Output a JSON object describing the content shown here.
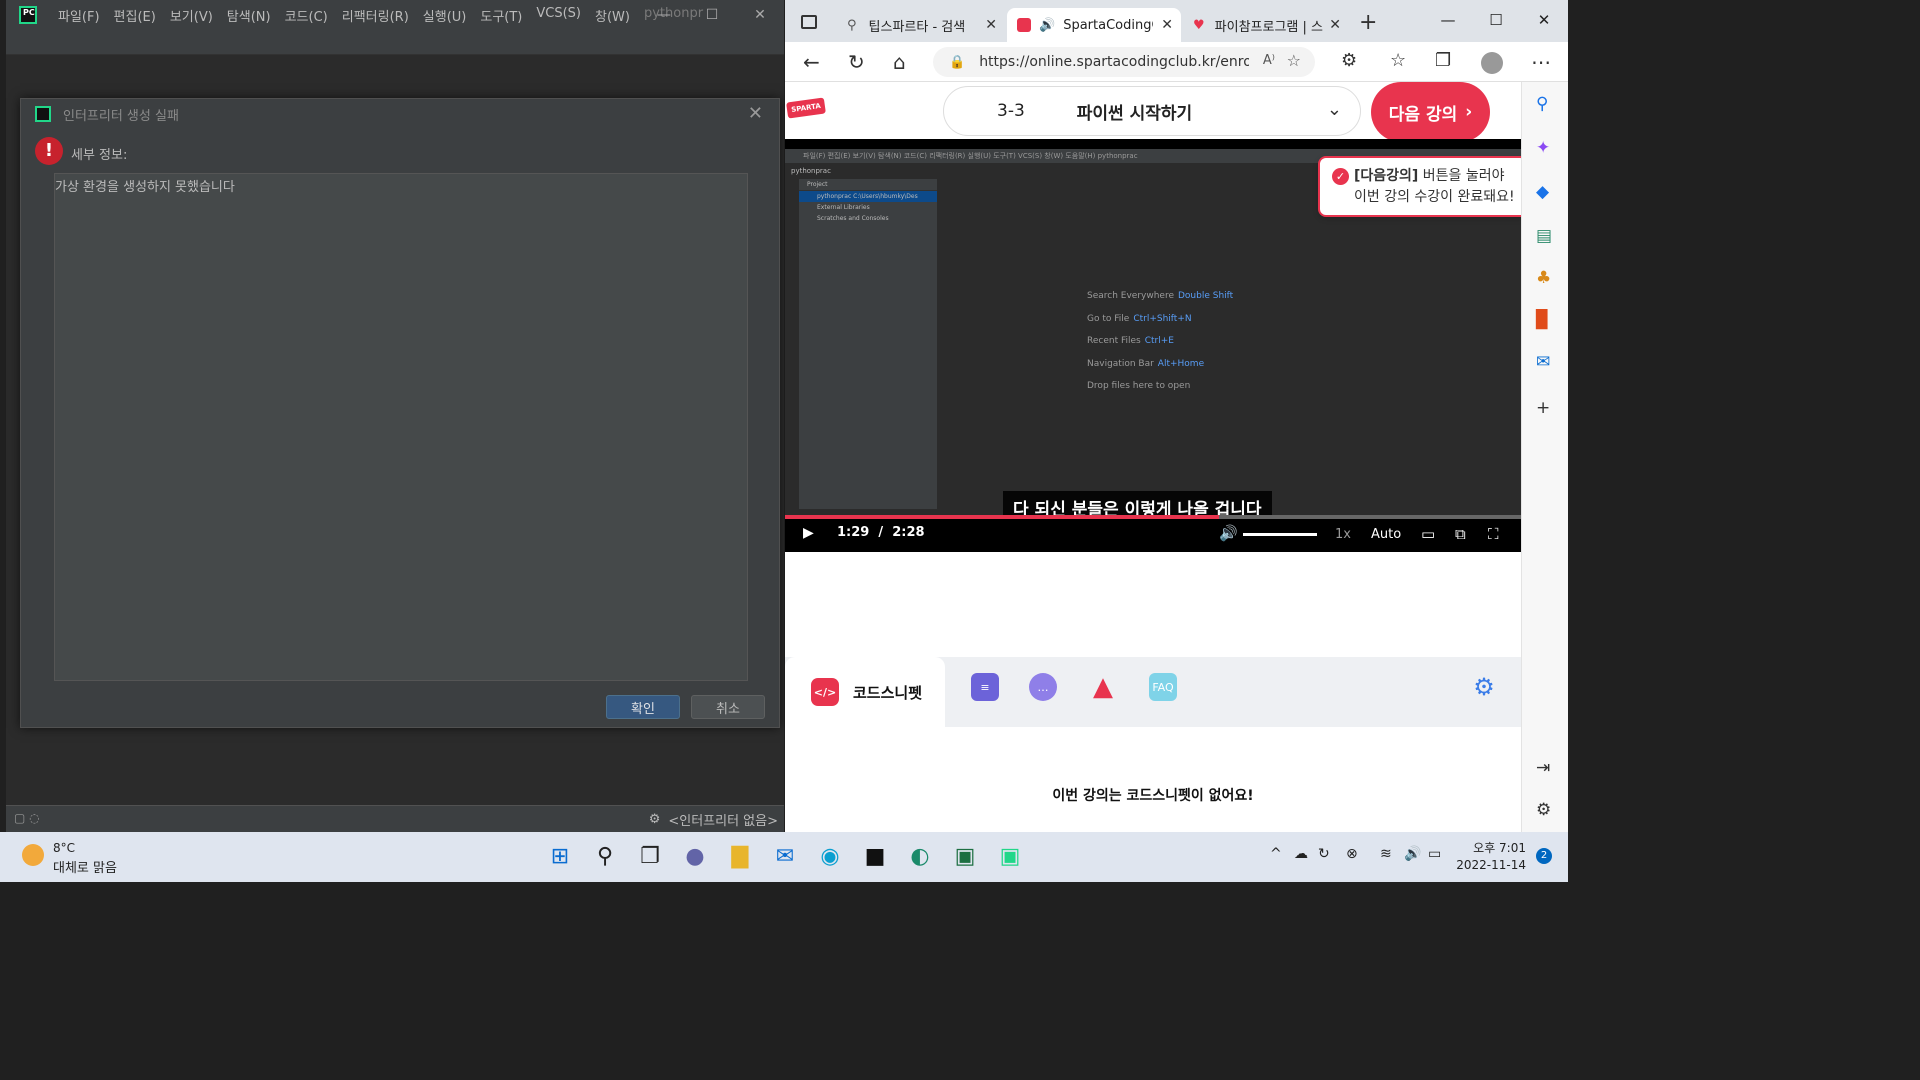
{
  "pycharm": {
    "menu": [
      "파일(F)",
      "편집(E)",
      "보기(V)",
      "탐색(N)",
      "코드(C)",
      "리팩터링(R)",
      "실행(U)",
      "도구(T)",
      "VCS(S)",
      "창(W)"
    ],
    "project_name": "pythonpr",
    "status_right": "<인터프리터 없음>",
    "dialog": {
      "title": "인터프리터 생성 실패",
      "detail_label": "세부 정보:",
      "detail_text": "가상 환경을 생성하지 못했습니다",
      "ok": "확인",
      "cancel": "취소"
    }
  },
  "edge": {
    "tabs": [
      {
        "label": "팁스파르타 - 검색",
        "icon": "search-icon"
      },
      {
        "label": "SpartaCodingC",
        "icon": "sparta-icon"
      },
      {
        "label": "파이참프로그램 | 스",
        "icon": "heart-icon"
      }
    ],
    "url": "https://online.spartacodingclub.kr/enrol...",
    "page": {
      "logo_text": "SPARTA",
      "lecture_number": "3-3",
      "lecture_title": "파이썬 시작하기",
      "next_button": "다음 강의",
      "tooltip_line1_bold": "[다음강의]",
      "tooltip_line1_rest": " 버튼을 눌러야",
      "tooltip_line2": "이번 강의 수강이 완료돼요!",
      "video": {
        "current_time": "1:29",
        "total_time": "2:28",
        "progress": 0.59,
        "rate": "1x",
        "quality": "Auto",
        "subtitle": "다 되신 분들은 이렇게 나올 겁니다",
        "inner_menu": "파일(F)   편집(E)   보기(V)   탐색(N)   코드(C)   리팩터링(R)   실행(U)   도구(T)   VCS(S)   창(W)   도움말(H)       pythonprac",
        "inner_project": "pythonprac",
        "inner_tree_header": "Project",
        "inner_tree": [
          "pythonprac  C:\\Users\\hbumky\\Des",
          "External Libraries",
          "Scratches and Consoles"
        ],
        "hints": [
          {
            "label": "Search Everywhere",
            "key": "Double Shift"
          },
          {
            "label": "Go to File",
            "key": "Ctrl+Shift+N"
          },
          {
            "label": "Recent Files",
            "key": "Ctrl+E"
          },
          {
            "label": "Navigation Bar",
            "key": "Alt+Home"
          },
          {
            "label": "Drop files here to open",
            "key": ""
          }
        ]
      },
      "panel": {
        "active_tab": "코드스니펫",
        "code_icon_text": "</>",
        "faq_text": "FAQ",
        "message": "이번 강의는 코드스니펫이 없어요!"
      }
    }
  },
  "taskbar": {
    "temperature": "8°C",
    "weather": "대체로 맑음",
    "time": "오후 7:01",
    "date": "2022-11-14",
    "notifications": "2"
  },
  "colors": {
    "accent_red": "#e8344e",
    "pycharm_bg": "#2b2b2b",
    "pycharm_ok": "#365880"
  }
}
